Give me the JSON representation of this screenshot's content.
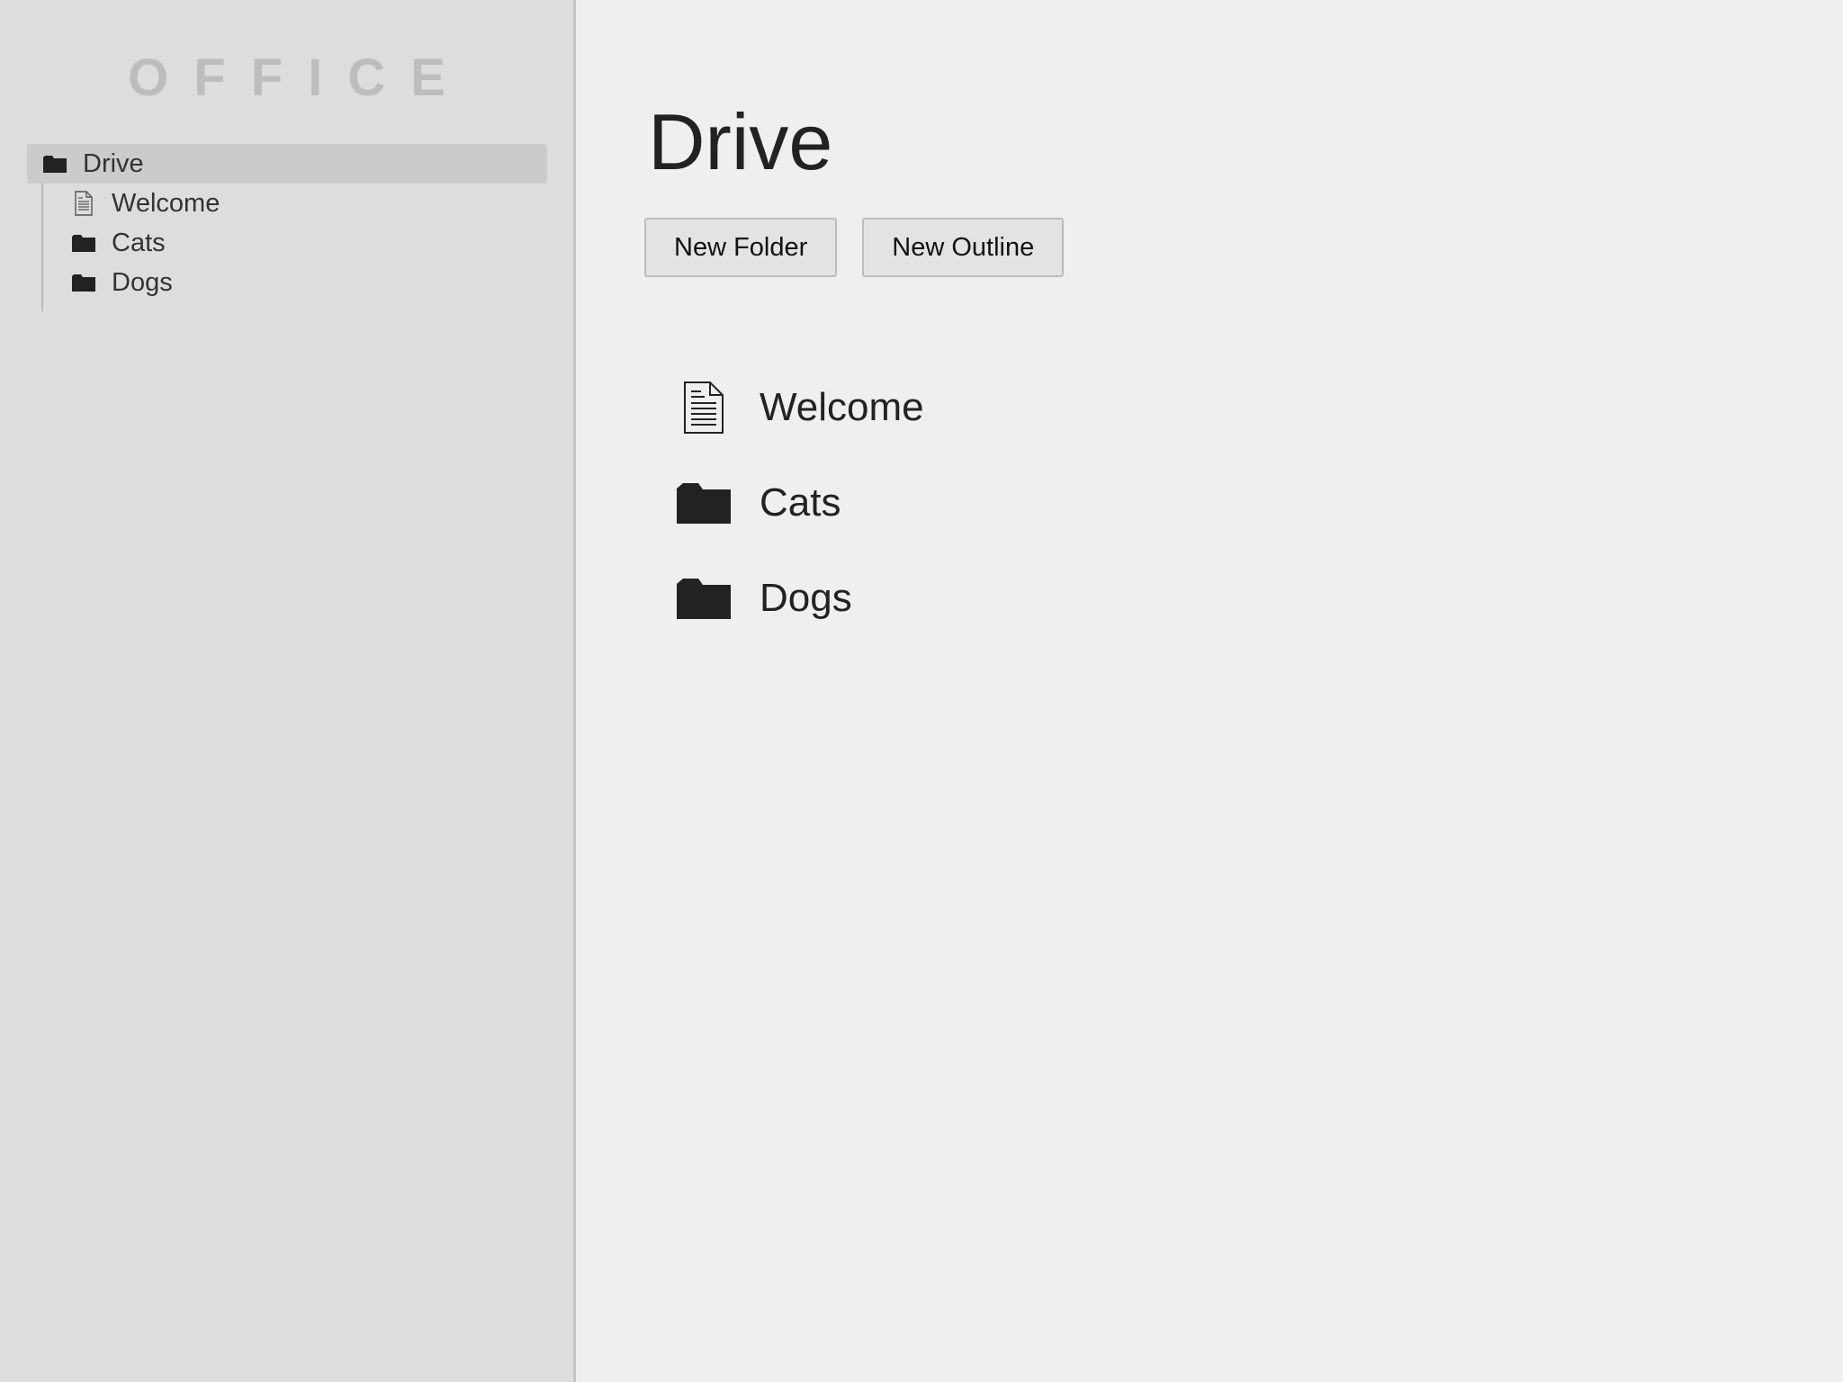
{
  "sidebar": {
    "brand": "OFFICE",
    "root": {
      "label": "Drive",
      "icon": "folder-icon"
    },
    "items": [
      {
        "label": "Welcome",
        "icon": "document-icon"
      },
      {
        "label": "Cats",
        "icon": "folder-icon"
      },
      {
        "label": "Dogs",
        "icon": "folder-icon"
      }
    ]
  },
  "main": {
    "title": "Drive",
    "actions": {
      "new_folder": "New Folder",
      "new_outline": "New Outline"
    },
    "entries": [
      {
        "label": "Welcome",
        "icon": "document-icon"
      },
      {
        "label": "Cats",
        "icon": "folder-icon"
      },
      {
        "label": "Dogs",
        "icon": "folder-icon"
      }
    ]
  },
  "colors": {
    "sidebar_bg": "#dddddd",
    "main_bg": "#efefef",
    "selected_bg": "#cbcbcb",
    "brand": "#bdbdbd",
    "icon": "#222222"
  }
}
